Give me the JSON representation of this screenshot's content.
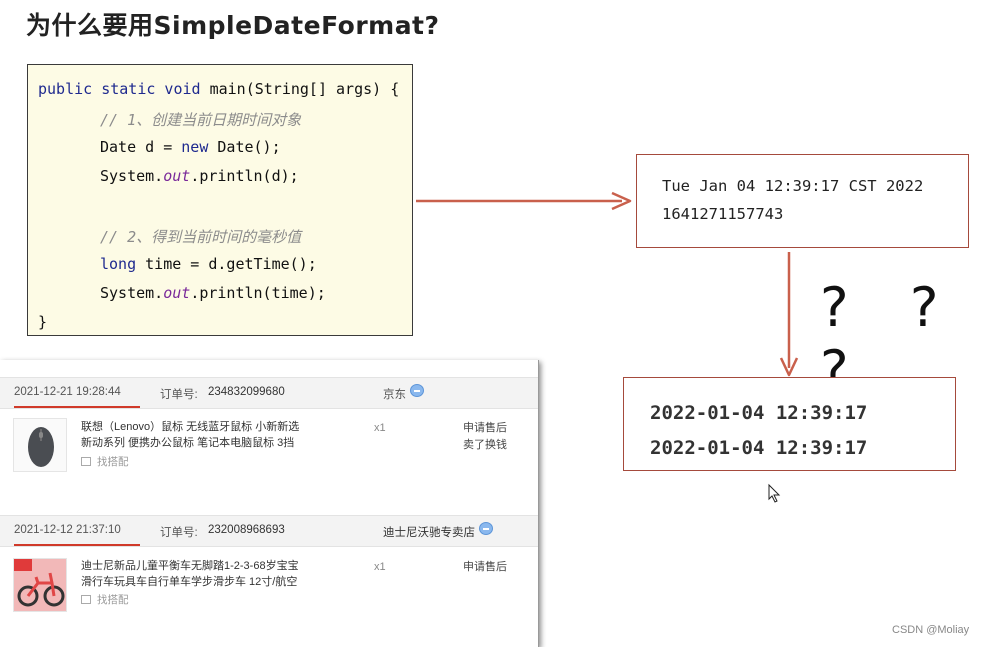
{
  "title": "为什么要用SimpleDateFormat?",
  "code": {
    "l1_kw": "public static void",
    "l1_rest": " main(String[] args) {",
    "l2": "// 1、创建当前日期时间对象",
    "l3_a": "Date d = ",
    "l3_kw": "new",
    "l3_b": " Date();",
    "l4_a": "System.",
    "l4_field": "out",
    "l4_b": ".println(d);",
    "l5": "// 2、得到当前时间的毫秒值",
    "l6_kw": "long",
    "l6_rest": " time = d.getTime();",
    "l7_a": "System.",
    "l7_field": "out",
    "l7_b": ".println(time);",
    "l8": "}"
  },
  "output1": {
    "line1": "Tue Jan 04 12:39:17 CST 2022",
    "line2": "1641271157743"
  },
  "question_marks": "? ? ?",
  "output2": {
    "line1": "2022-01-04 12:39:17",
    "line2": "2022-01-04 12:39:17"
  },
  "orders": [
    {
      "datetime": "2021-12-21 19:28:44",
      "order_label": "订单号:",
      "order_no": "234832099680",
      "shop": "京东",
      "desc_line1": "联想（Lenovo）鼠标 无线蓝牙鼠标 小新新选",
      "desc_line2": "新动系列 便携办公鼠标 笔记本电脑鼠标 3挡",
      "tag": "找搭配",
      "qty": "x1",
      "action1": "申请售后",
      "action2": "卖了换钱"
    },
    {
      "datetime": "2021-12-12 21:37:10",
      "order_label": "订单号:",
      "order_no": "232008968693",
      "shop": "迪士尼沃驰专卖店",
      "desc_line1": "迪士尼新品儿童平衡车无脚踏1-2-3-68岁宝宝",
      "desc_line2": "滑行车玩具车自行单车学步滑步车 12寸/航空",
      "tag": "找搭配",
      "qty": "x1",
      "action1": "申请售后"
    }
  ],
  "watermark": "CSDN @Moliay",
  "colors": {
    "arrow": "#c9604c",
    "keyword": "#1f2a8f",
    "comment": "#8c8c8c",
    "field": "#7a2a9a",
    "underline": "#d03a2a"
  }
}
